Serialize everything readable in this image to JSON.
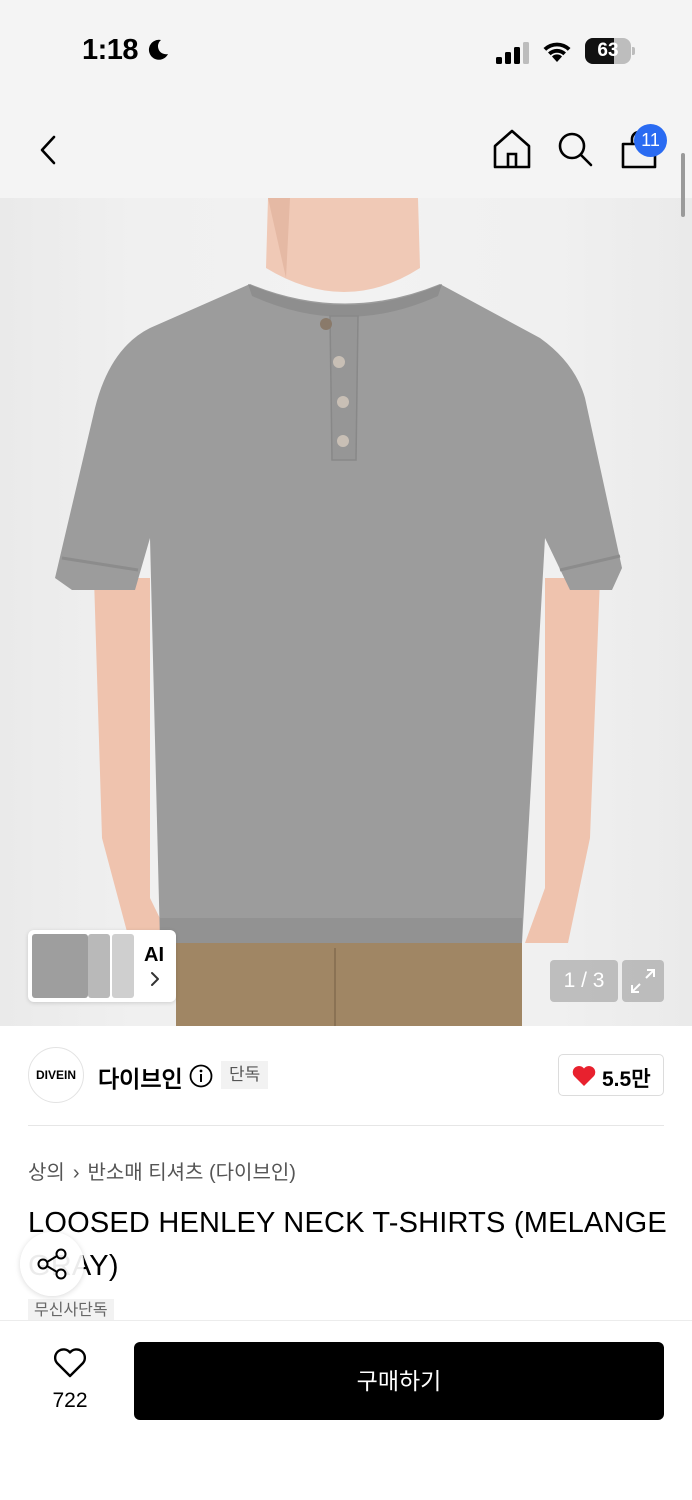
{
  "status_bar": {
    "time": "1:18",
    "battery_percent": 63,
    "battery_label": "63"
  },
  "nav": {
    "cart_count": "11",
    "icons": [
      "back-icon",
      "home-icon",
      "search-icon",
      "shopping-bag-icon"
    ]
  },
  "gallery": {
    "ai_label": "AI",
    "page_counter": "1 / 3"
  },
  "brand": {
    "logo_text": "DIVEIN",
    "name": "다이브인",
    "tag": "단독",
    "likes": "5.5만"
  },
  "breadcrumb": [
    "상의",
    "반소매 티셔츠 (다이브인)"
  ],
  "product": {
    "title": "LOOSED HENLEY NECK T-SHIRTS (MELANGE GRAY)",
    "sub_tag": "무신사단독"
  },
  "bottom_bar": {
    "wish_count": "722",
    "buy_label": "구매하기"
  },
  "colors": {
    "badge_blue": "#2a6bf2",
    "heart_red": "#e8212e",
    "shirt_gray": "#9b9b9b",
    "pants_brown": "#a08664"
  }
}
